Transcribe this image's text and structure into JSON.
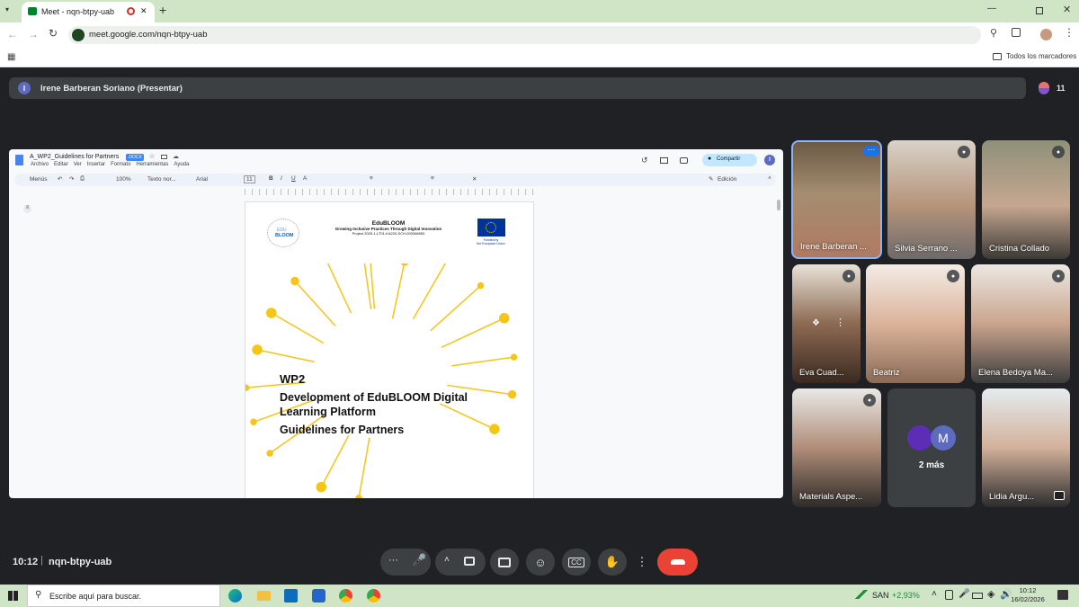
{
  "browser": {
    "tab_title": "Meet - nqn-btpy-uab",
    "url": "meet.google.com/nqn-btpy-uab",
    "bookmarks_label": "Todos los marcadores",
    "new_tab_symbol": "+",
    "tab_close_symbol": "✕"
  },
  "meet": {
    "presenter_initial": "I",
    "presenter_label": "Irene Barberan Soriano (Presentar)",
    "participant_count": "11",
    "time": "10:12",
    "meeting_code": "nqn-btpy-uab",
    "more_label": "2 más",
    "more_initial": "M",
    "participants": [
      {
        "name": "Irene Barberan ...",
        "muted": false
      },
      {
        "name": "Silvia Serrano ...",
        "muted": true
      },
      {
        "name": "Cristina Collado",
        "muted": true
      },
      {
        "name": "Eva Cuad...",
        "muted": true
      },
      {
        "name": "Beatriz",
        "muted": true
      },
      {
        "name": "Elena Bedoya Ma...",
        "muted": true
      },
      {
        "name": "Materials Aspe...",
        "muted": true
      },
      {
        "name": "Lidia Argu...",
        "muted": false
      }
    ]
  },
  "doc": {
    "title": "A_WP2_Guidelines for Partners",
    "badge": ".DOCX",
    "menus": [
      "Archivo",
      "Editar",
      "Ver",
      "Insertar",
      "Formato",
      "Herramientas",
      "Ayuda"
    ],
    "menus_search": "Menús",
    "zoom": "100%",
    "style": "Texto nor...",
    "font": "Arial",
    "font_size": "11",
    "share_label": "Compartir",
    "mode_label": "Edición",
    "user_initial": "I",
    "header_title": "EduBLOOM",
    "header_subtitle": "Growing Inclusive Practices Through Digital Innovation",
    "header_project": "Project 2025-1-LT01-KA220-SCH-000366650",
    "logo_top": "EDU",
    "logo_bottom": "BLOOM",
    "eu_label_1": "Funded by",
    "eu_label_2": "the European Union",
    "wp": "WP2",
    "heading_1": "Development of EduBLOOM Digital",
    "heading_2": "Learning Platform",
    "heading_3": "Guidelines for Partners"
  },
  "taskbar": {
    "search_placeholder": "Escribe aquí para buscar.",
    "stock_name": "SAN",
    "stock_change": "+2,93%",
    "clock_time": "10:12",
    "clock_date": "16/02/2026"
  },
  "colors": {
    "accent_green": "#cfe5c6",
    "meet_bg": "#202124",
    "end_call": "#ea4335",
    "bloom_yellow": "#f5c518",
    "avatar_purple": "#5c2eb8"
  }
}
